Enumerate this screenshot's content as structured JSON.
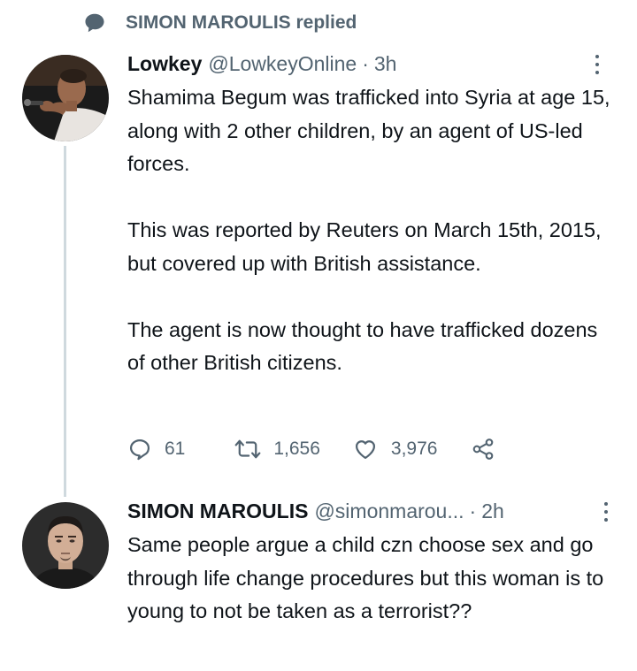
{
  "context": {
    "icon": "speech-bubble-icon",
    "text": "SIMON MAROULIS replied"
  },
  "tweet1": {
    "avatar": "lowkey-avatar",
    "name": "Lowkey",
    "handle": "@LowkeyOnline",
    "separator": "·",
    "time": "3h",
    "paragraphs": [
      "Shamima Begum was trafficked into Syria at age 15, along with 2 other children, by an agent of US-led forces.",
      "This was reported by Reuters on March 15th, 2015, but covered up with British assistance.",
      "The agent is now thought to have trafficked dozens of other British citizens."
    ],
    "actions": {
      "replies": "61",
      "retweets": "1,656",
      "likes": "3,976"
    }
  },
  "tweet2": {
    "avatar": "simon-maroulis-avatar",
    "name": "SIMON MAROULIS",
    "handle": "@simonmarou...",
    "separator": "·",
    "time": "2h",
    "text": "Same people argue a child czn choose sex and go through life change procedures but this woman is to young to not be taken as a terrorist??"
  },
  "colors": {
    "text": "#0f1419",
    "secondary": "#536471",
    "thread_line": "#cfd9de",
    "background": "#ffffff"
  }
}
